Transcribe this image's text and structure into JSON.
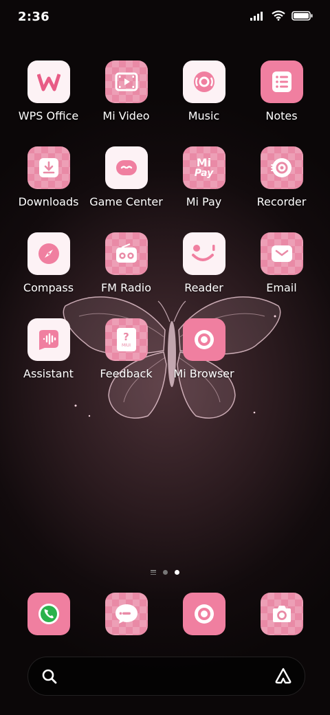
{
  "status": {
    "time": "2:36"
  },
  "apps": [
    {
      "label": "WPS Office",
      "icon": "wps-office-icon"
    },
    {
      "label": "Mi Video",
      "icon": "mi-video-icon"
    },
    {
      "label": "Music",
      "icon": "music-icon"
    },
    {
      "label": "Notes",
      "icon": "notes-icon"
    },
    {
      "label": "Downloads",
      "icon": "downloads-icon"
    },
    {
      "label": "Game Center",
      "icon": "game-center-icon"
    },
    {
      "label": "Mi Pay",
      "icon": "mi-pay-icon",
      "glyph_top": "Mi",
      "glyph_bottom": "Pay"
    },
    {
      "label": "Recorder",
      "icon": "recorder-icon"
    },
    {
      "label": "Compass",
      "icon": "compass-icon"
    },
    {
      "label": "FM Radio",
      "icon": "fm-radio-icon"
    },
    {
      "label": "Reader",
      "icon": "reader-icon"
    },
    {
      "label": "Email",
      "icon": "email-icon"
    },
    {
      "label": "Assistant",
      "icon": "assistant-icon"
    },
    {
      "label": "Feedback",
      "icon": "feedback-icon",
      "glyph_top": "?",
      "glyph_bottom": "MIUI"
    },
    {
      "label": "Mi Browser",
      "icon": "mi-browser-icon"
    }
  ],
  "dock": [
    {
      "icon": "phone-icon"
    },
    {
      "icon": "messages-icon"
    },
    {
      "icon": "browser-icon"
    },
    {
      "icon": "camera-icon"
    }
  ],
  "pages": {
    "count": 2,
    "active": 2
  },
  "colors": {
    "accent_pink": "#f07fa0",
    "icon_light": "#fdf2f5"
  }
}
